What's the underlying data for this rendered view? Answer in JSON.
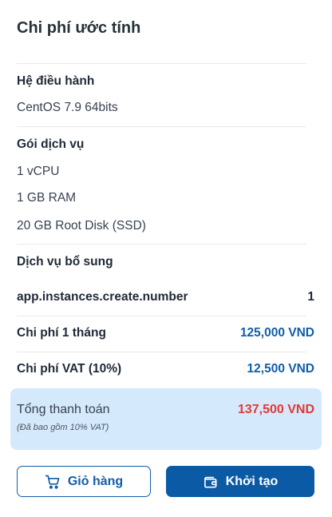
{
  "title": "Chi phí ước tính",
  "os": {
    "heading": "Hệ điều hành",
    "value": "CentOS 7.9 64bits"
  },
  "package": {
    "heading": "Gói dịch vụ",
    "items": [
      "1 vCPU",
      "1 GB RAM",
      "20 GB Root Disk (SSD)"
    ]
  },
  "addons": {
    "heading": "Dịch vụ bổ sung"
  },
  "instances": {
    "label": "app.instances.create.number",
    "value": "1"
  },
  "monthly": {
    "label": "Chi phí 1 tháng",
    "value": "125,000 VND"
  },
  "vat": {
    "label": "Chi phí VAT (10%)",
    "value": "12,500 VND"
  },
  "total": {
    "label": "Tổng thanh toán",
    "note": "(Đã bao gồm 10% VAT)",
    "value": "137,500 VND"
  },
  "buttons": {
    "cart_label": "Giỏ hàng",
    "create_label": "Khởi tạo"
  },
  "icons": {
    "cart": "cart-icon",
    "wallet": "wallet-icon"
  },
  "colors": {
    "primary": "#0b5aa6",
    "price": "#0f5ea8",
    "total_price": "#e53935",
    "total_bg": "#d4e9fb"
  }
}
